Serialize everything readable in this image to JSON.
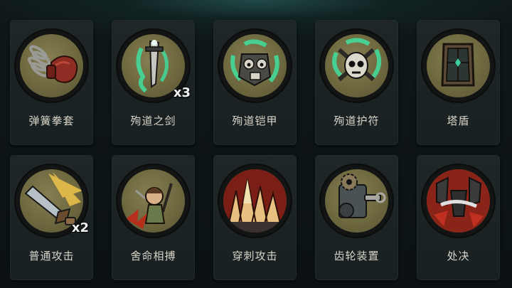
{
  "cards": [
    {
      "label": "弹簧拳套",
      "icon": "spring-glove-icon",
      "multiplier": ""
    },
    {
      "label": "殉道之剑",
      "icon": "martyr-sword-icon",
      "multiplier": "x3"
    },
    {
      "label": "殉道铠甲",
      "icon": "martyr-armor-icon",
      "multiplier": ""
    },
    {
      "label": "殉道护符",
      "icon": "martyr-amulet-icon",
      "multiplier": ""
    },
    {
      "label": "塔盾",
      "icon": "tower-shield-icon",
      "multiplier": ""
    },
    {
      "label": "普通攻击",
      "icon": "basic-attack-sword-icon",
      "multiplier": "x2"
    },
    {
      "label": "舍命相搏",
      "icon": "desperate-fight-icon",
      "multiplier": ""
    },
    {
      "label": "穿刺攻击",
      "icon": "spike-attack-icon",
      "multiplier": ""
    },
    {
      "label": "齿轮装置",
      "icon": "gear-device-icon",
      "multiplier": ""
    },
    {
      "label": "处决",
      "icon": "execution-icon",
      "multiplier": ""
    }
  ],
  "colors": {
    "background": "#0d1416",
    "card": "#1e2628",
    "medallion_disc": "#6e683f",
    "label_text": "#d9d4c8",
    "ghost_green": "#3fe0a0"
  }
}
